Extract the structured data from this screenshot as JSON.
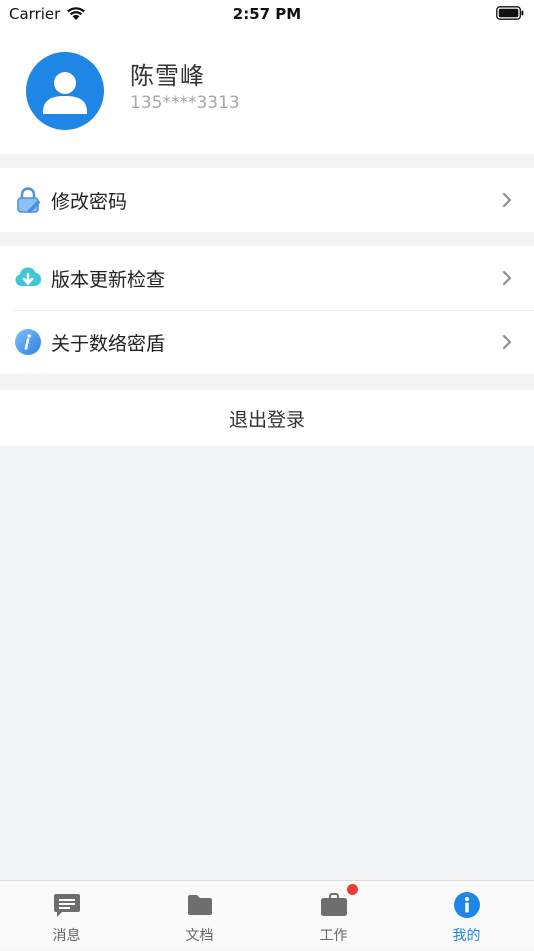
{
  "status_bar": {
    "carrier": "Carrier",
    "time": "2:57 PM"
  },
  "profile": {
    "name": "陈雪峰",
    "phone": "135****3313"
  },
  "menu": {
    "change_password": "修改密码",
    "check_update": "版本更新检查",
    "about": "关于数络密盾"
  },
  "logout_label": "退出登录",
  "tabs": {
    "messages": "消息",
    "documents": "文档",
    "work": "工作",
    "mine": "我的"
  },
  "colors": {
    "accent": "#1f86e6",
    "badge": "#f03a3a",
    "background": "#f2f3f5"
  },
  "icons": {
    "change_password": "lock-icon",
    "check_update": "cloud-download-icon",
    "about": "info-icon"
  }
}
